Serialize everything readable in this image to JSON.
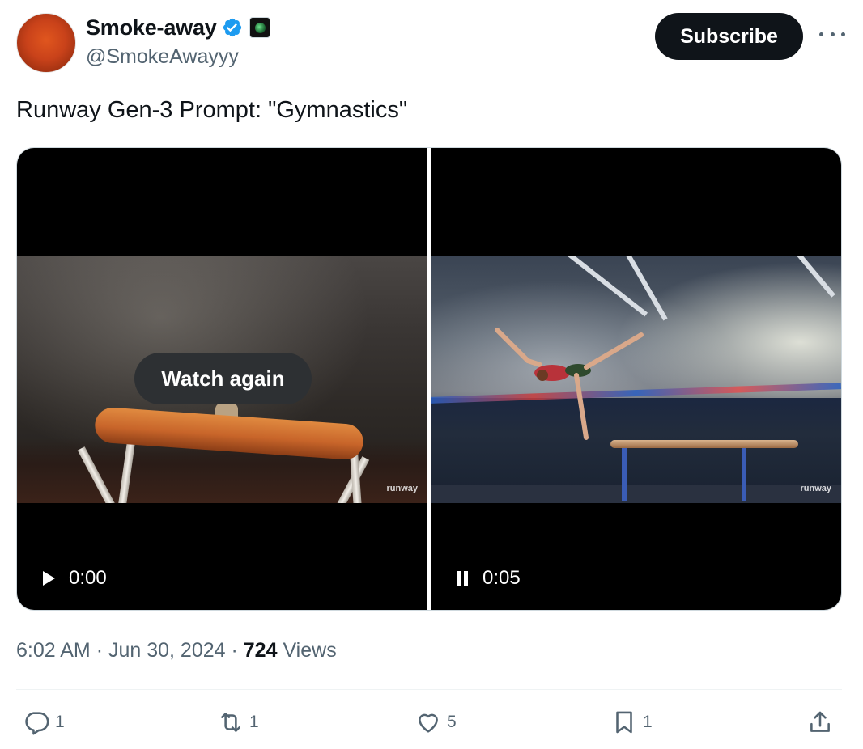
{
  "author": {
    "display_name": "Smoke-away",
    "handle": "@SmokeAwayyy",
    "verified_icon": "verified-badge-icon",
    "affiliation_icon": "affiliate-badge-icon"
  },
  "header": {
    "subscribe_label": "Subscribe",
    "more_icon": "more-dots-icon"
  },
  "tweet": {
    "text": "Runway Gen-3 Prompt: \"Gymnastics\""
  },
  "media": {
    "videos": [
      {
        "watch_again_label": "Watch again",
        "control_icon": "play-icon",
        "time": "0:00",
        "watermark": "runway"
      },
      {
        "control_icon": "pause-icon",
        "time": "0:05",
        "watermark": "runway"
      }
    ]
  },
  "meta": {
    "time": "6:02 AM",
    "separator": "·",
    "date": "Jun 30, 2024",
    "views_count": "724",
    "views_label": "Views"
  },
  "actions": {
    "reply_count": "1",
    "repost_count": "1",
    "like_count": "5",
    "bookmark_count": "1"
  },
  "colors": {
    "text_primary": "#0f1419",
    "text_secondary": "#536471",
    "verified_blue": "#1d9bf0",
    "divider": "#eff3f4",
    "subscribe_bg": "#0f1419"
  }
}
